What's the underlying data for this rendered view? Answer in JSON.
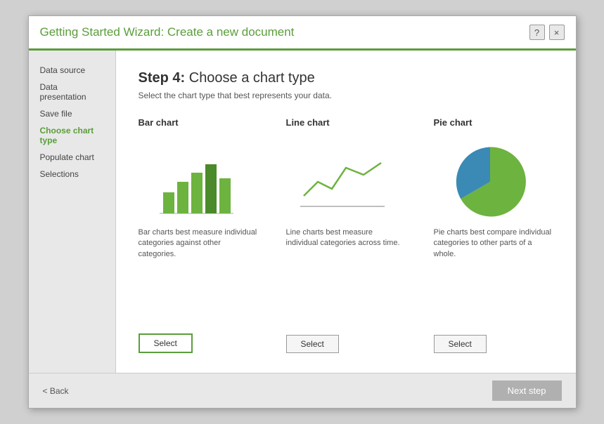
{
  "dialog": {
    "title": "Getting Started Wizard: Create a new document",
    "help_btn": "?",
    "close_btn": "×"
  },
  "sidebar": {
    "items": [
      {
        "label": "Data source",
        "active": false
      },
      {
        "label": "Data presentation",
        "active": false
      },
      {
        "label": "Save file",
        "active": false
      },
      {
        "label": "Choose chart type",
        "active": true
      },
      {
        "label": "Populate chart",
        "active": false
      },
      {
        "label": "Selections",
        "active": false
      }
    ]
  },
  "main": {
    "step_number": "Step 4:",
    "step_title": " Choose a chart type",
    "subtitle": "Select the chart type that best represents your data.",
    "charts": [
      {
        "title": "Bar chart",
        "description": "Bar charts best measure individual categories against other categories.",
        "select_label": "Select",
        "selected": true
      },
      {
        "title": "Line chart",
        "description": "Line charts best measure individual categories across time.",
        "select_label": "Select",
        "selected": false
      },
      {
        "title": "Pie chart",
        "description": "Pie charts best compare individual categories to other parts of a whole.",
        "select_label": "Select",
        "selected": false
      }
    ]
  },
  "footer": {
    "back_label": "< Back",
    "next_label": "Next step"
  }
}
